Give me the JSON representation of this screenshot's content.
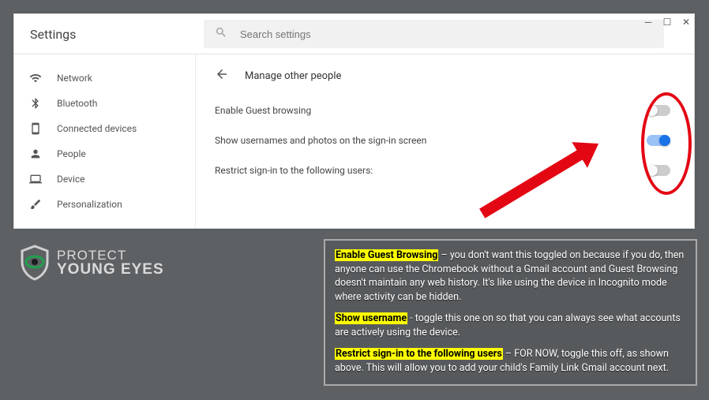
{
  "header": {
    "title": "Settings",
    "search_placeholder": "Search settings"
  },
  "sidebar": {
    "items": [
      {
        "label": "Network",
        "icon": "wifi"
      },
      {
        "label": "Bluetooth",
        "icon": "bluetooth"
      },
      {
        "label": "Connected devices",
        "icon": "devices"
      },
      {
        "label": "People",
        "icon": "person"
      },
      {
        "label": "Device",
        "icon": "laptop"
      },
      {
        "label": "Personalization",
        "icon": "brush"
      }
    ]
  },
  "main": {
    "breadcrumb": "Manage other people",
    "rows": [
      {
        "label": "Enable Guest browsing",
        "on": false
      },
      {
        "label": "Show usernames and photos on the sign-in screen",
        "on": true
      },
      {
        "label": "Restrict sign-in to the following users:",
        "on": false
      }
    ]
  },
  "logo": {
    "top": "PROTECT",
    "bottom": "YOUNG EYES"
  },
  "callout": {
    "p1a": "Enable Guest Browsing",
    "p1b": " – you don't want this toggled on because if you do, then anyone can use the Chromebook without a Gmail account and Guest Browsing doesn't maintain any web history. It's like using the device in Incognito mode where activity can be hidden.",
    "p2a": "Show username",
    "p2b": " - toggle this one on so that you can always see what accounts are actively using the device.",
    "p3a": "Restrict sign-in to the following users",
    "p3b": " – FOR NOW, toggle this off, as shown above. This will allow you to add your child's Family Link Gmail account next."
  }
}
